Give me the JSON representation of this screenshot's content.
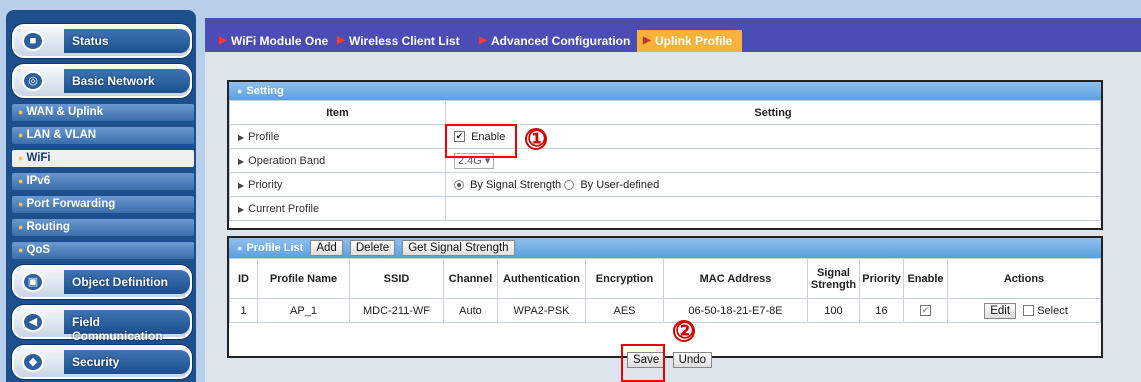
{
  "sidebar": {
    "big_items": [
      {
        "label": "Status",
        "icon": "chart-icon"
      },
      {
        "label": "Basic Network",
        "icon": "network-icon"
      }
    ],
    "sub_items": [
      "WAN & Uplink",
      "LAN & VLAN",
      "WiFi",
      "IPv6",
      "Port Forwarding",
      "Routing",
      "QoS"
    ],
    "bottom_items": [
      {
        "label": "Object Definition",
        "icon": "object-icon"
      },
      {
        "label": "Field Communication",
        "icon": "field-icon"
      },
      {
        "label": "Security",
        "icon": "shield-icon"
      }
    ]
  },
  "tabs": [
    "WiFi Module One",
    "Wireless Client List",
    "Advanced Configuration",
    "Uplink Profile"
  ],
  "setting": {
    "title": "Setting",
    "col_item": "Item",
    "col_setting": "Setting",
    "rows": {
      "profile": "Profile",
      "enable": "Enable",
      "band_label": "Operation Band",
      "band_value": "2.4G",
      "priority_label": "Priority",
      "priority_opt1": "By Signal Strength",
      "priority_opt2": "By User-defined",
      "current": "Current Profile"
    }
  },
  "profile_list": {
    "title": "Profile List",
    "add": "Add",
    "delete": "Delete",
    "signal": "Get Signal Strength",
    "headers": [
      "ID",
      "Profile Name",
      "SSID",
      "Channel",
      "Authentication",
      "Encryption",
      "MAC Address",
      "Signal Strength",
      "Priority",
      "Enable",
      "Actions"
    ],
    "row": {
      "id": "1",
      "name": "AP_1",
      "ssid": "MDC-211-WF",
      "channel": "Auto",
      "auth": "WPA2-PSK",
      "enc": "AES",
      "mac": "06-50-18-21-E7-8E",
      "signal": "100",
      "priority": "16",
      "edit": "Edit",
      "select": "Select"
    }
  },
  "footer": {
    "save": "Save",
    "undo": "Undo"
  },
  "callouts": [
    "①",
    "②"
  ]
}
